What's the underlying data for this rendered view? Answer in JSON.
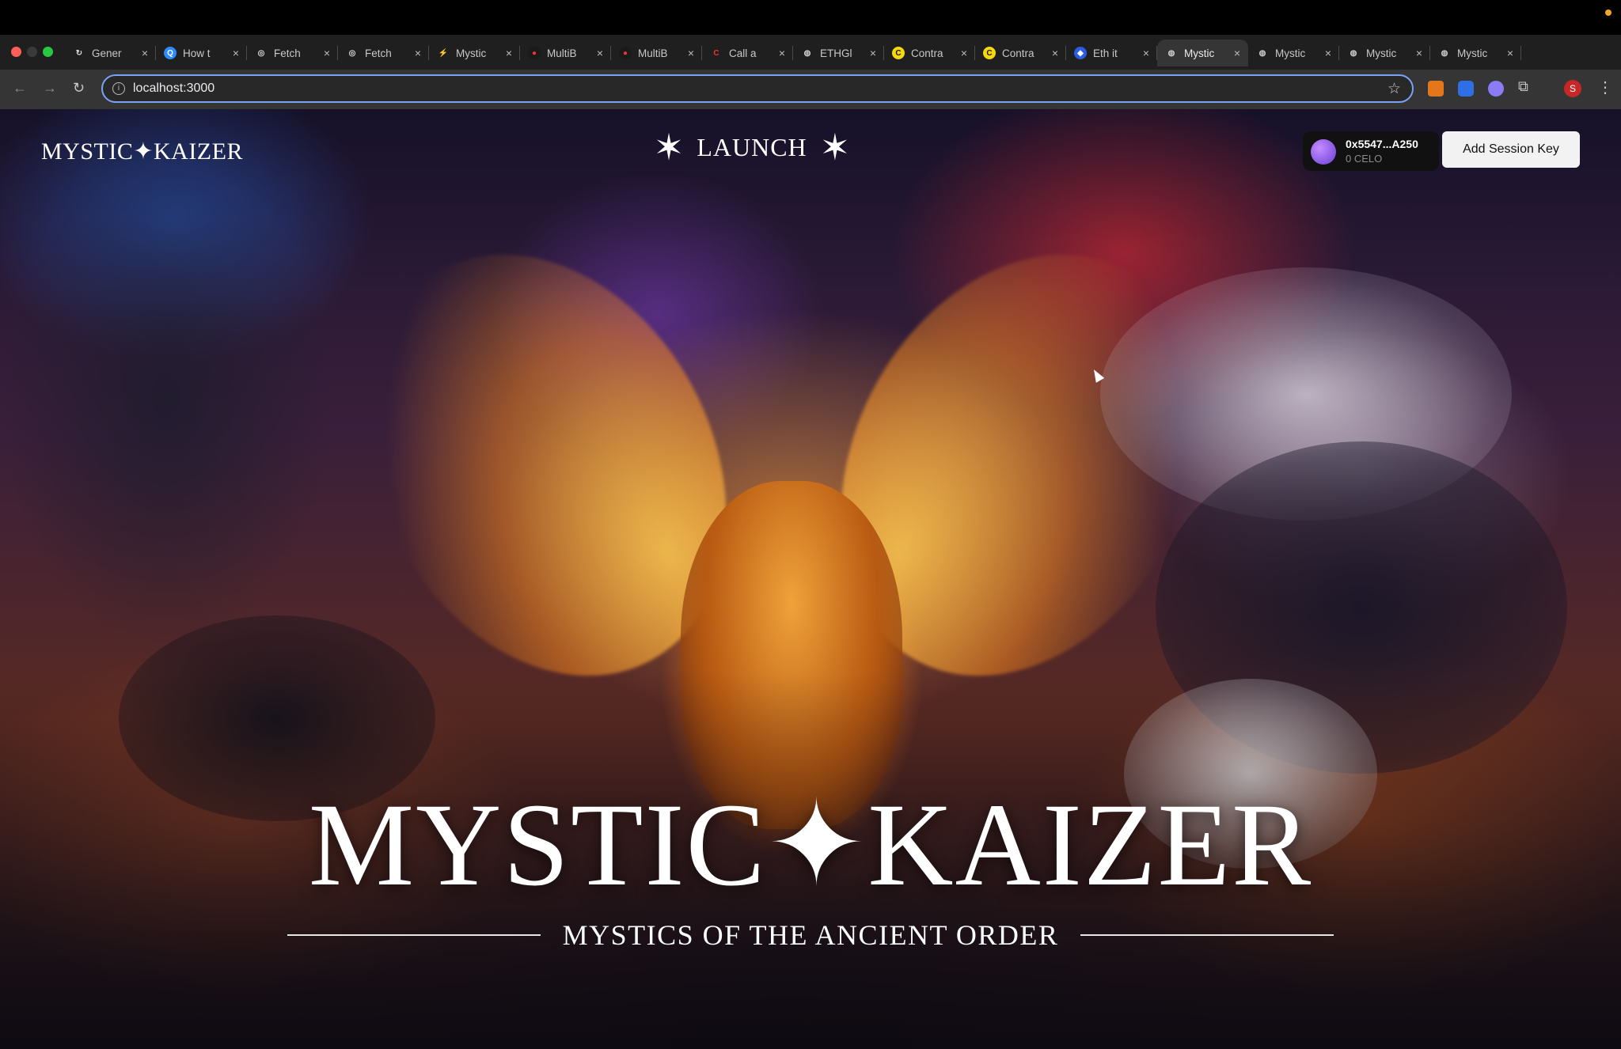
{
  "browser": {
    "tabs": [
      {
        "label": "Gener",
        "icon": "sync-icon",
        "active": false
      },
      {
        "label": "How t",
        "icon": "question-icon",
        "active": false
      },
      {
        "label": "Fetch",
        "icon": "target-icon",
        "active": false
      },
      {
        "label": "Fetch",
        "icon": "target-icon",
        "active": false
      },
      {
        "label": "Mystic",
        "icon": "bolt-icon",
        "active": false
      },
      {
        "label": "MultiB",
        "icon": "record-icon",
        "active": false
      },
      {
        "label": "MultiB",
        "icon": "record-icon",
        "active": false
      },
      {
        "label": "Call a",
        "icon": "loop-icon",
        "active": false
      },
      {
        "label": "ETHGl",
        "icon": "globe-icon",
        "active": false
      },
      {
        "label": "Contra",
        "icon": "c-icon",
        "active": false
      },
      {
        "label": "Contra",
        "icon": "c-icon",
        "active": false
      },
      {
        "label": "Eth it",
        "icon": "shield-icon",
        "active": false
      },
      {
        "label": "Mystic",
        "icon": "globe-icon",
        "active": true
      },
      {
        "label": "Mystic",
        "icon": "globe-icon",
        "active": false
      },
      {
        "label": "Mystic",
        "icon": "globe-icon",
        "active": false
      },
      {
        "label": "Mystic",
        "icon": "globe-icon",
        "active": false
      }
    ],
    "close_glyph": "×",
    "new_tab": "+",
    "url": "localhost:3000",
    "profile_initial": "S"
  },
  "page": {
    "brand": "MYSTIC✦KAIZER",
    "launch_label": "LAUNCH",
    "wallet": {
      "address": "0x5547...A250",
      "balance": "0 CELO"
    },
    "session_button": "Add Session Key",
    "hero_title": "MYSTIC✦KAIZER",
    "hero_subtitle": "MYSTICS OF THE ANCIENT ORDER"
  },
  "colors": {
    "accent_blue": "#7aa2f7",
    "tab_active": "#353535",
    "button_bg": "#f2f2f2"
  }
}
